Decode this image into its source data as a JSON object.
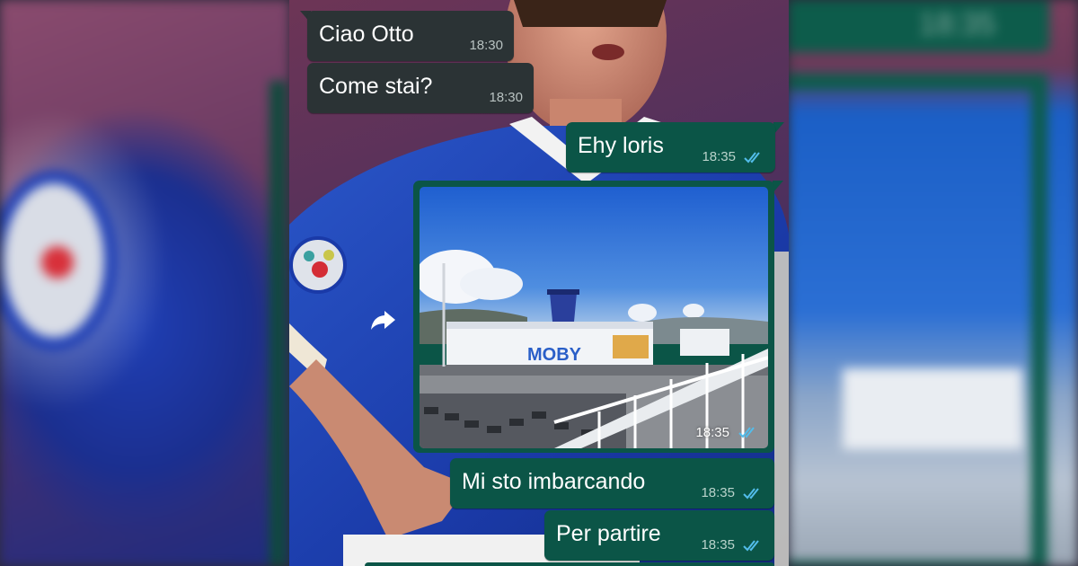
{
  "chat": {
    "messages": [
      {
        "direction": "incoming",
        "text": "Ciao Otto",
        "time": "18:30"
      },
      {
        "direction": "incoming",
        "text": "Come stai?",
        "time": "18:30"
      },
      {
        "direction": "outgoing",
        "text": "Ehy loris",
        "time": "18:35",
        "status": "read"
      },
      {
        "direction": "outgoing",
        "type": "image",
        "image_text": "MOBY",
        "time": "18:35",
        "status": "read"
      },
      {
        "direction": "outgoing",
        "text": "Mi sto imbarcando",
        "time": "18:35",
        "status": "read"
      },
      {
        "direction": "outgoing",
        "text": "Per partire",
        "time": "18:35",
        "status": "read"
      }
    ],
    "forward_icon": "forward-arrow-icon",
    "read_ticks_icon": "double-check-icon"
  },
  "background_right": {
    "time": "18:35"
  },
  "colors": {
    "incoming_bubble": "#2b3335",
    "outgoing_bubble": "#0b5547",
    "read_ticks": "#53bdeb",
    "timestamp": "#b9d3cb"
  }
}
